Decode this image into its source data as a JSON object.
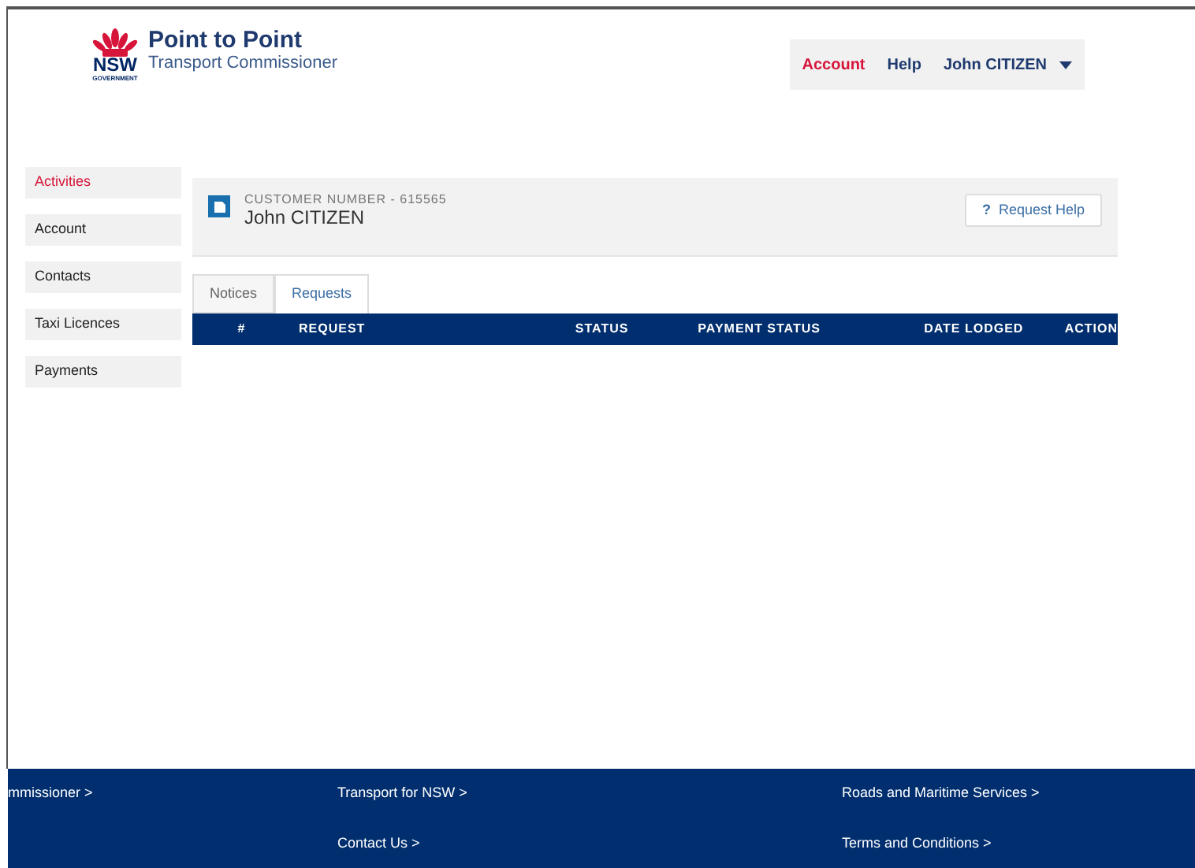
{
  "brand": {
    "mark": "NSW",
    "mark_sub": "GOVERNMENT",
    "title": "Point to Point",
    "subtitle": "Transport Commissioner"
  },
  "topnav": {
    "items": [
      {
        "label": "Account",
        "selected": true
      },
      {
        "label": "Help",
        "selected": false
      }
    ],
    "user": "John CITIZEN"
  },
  "sidebar": {
    "items": [
      {
        "label": "Activities",
        "selected": true
      },
      {
        "label": "Account",
        "selected": false
      },
      {
        "label": "Contacts",
        "selected": false
      },
      {
        "label": "Taxi Licences",
        "selected": false
      },
      {
        "label": "Payments",
        "selected": false
      }
    ]
  },
  "customer": {
    "number_label": "CUSTOMER NUMBER - 615565",
    "name": "John CITIZEN",
    "help_button": "Request Help",
    "help_glyph": "?"
  },
  "tabs": [
    {
      "label": "Notices",
      "selected": false
    },
    {
      "label": "Requests",
      "selected": true
    }
  ],
  "table": {
    "columns": [
      "#",
      "REQUEST",
      "STATUS",
      "PAYMENT STATUS",
      "DATE LODGED",
      "ACTION"
    ]
  },
  "footer": {
    "links": [
      "mmissioner >",
      "Transport for NSW >",
      "Roads and Maritime Services >",
      "Contact Us >",
      "Terms and Conditions >"
    ]
  }
}
